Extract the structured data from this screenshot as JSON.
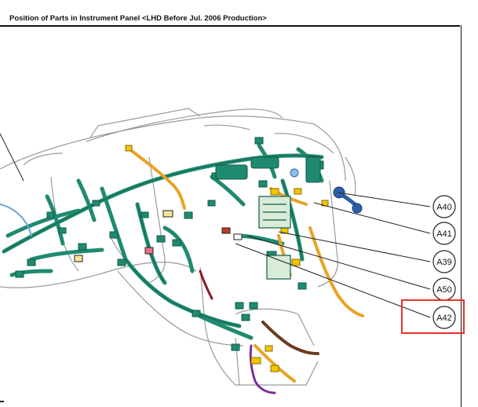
{
  "header": {
    "title": "Position of Parts in Instrument Panel <LHD Before Jul. 2006 Production>"
  },
  "callouts": [
    {
      "id": "A40",
      "label": "A40",
      "highlighted": false
    },
    {
      "id": "A41",
      "label": "A41",
      "highlighted": false
    },
    {
      "id": "A39",
      "label": "A39",
      "highlighted": false
    },
    {
      "id": "A50",
      "label": "A50",
      "highlighted": false
    },
    {
      "id": "A42",
      "label": "A42",
      "highlighted": true
    }
  ],
  "colors": {
    "harness_green": "#1f8a70",
    "harness_dark": "#0f5a48",
    "harness_orange": "#e8a325",
    "connector_yellow": "#f2c500",
    "highlight_red": "#e5332a",
    "outline": "#222222",
    "accent_blue": "#2d5fa8",
    "accent_purple": "#7a2e9c",
    "accent_brown": "#6b3a1f"
  }
}
